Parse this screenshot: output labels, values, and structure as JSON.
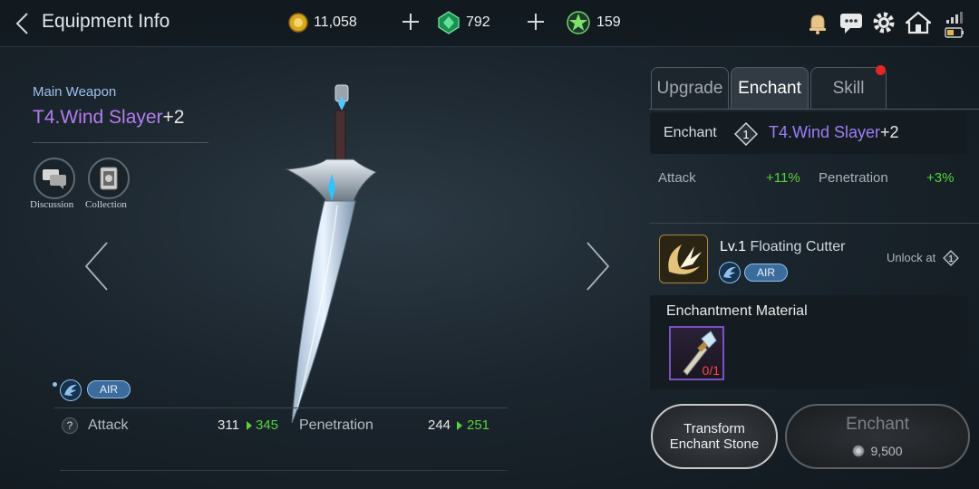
{
  "header": {
    "title": "Equipment Info",
    "gold": "11,058",
    "gems": "792",
    "stones": "159"
  },
  "weapon": {
    "type": "Main Weapon",
    "name": "T4.Wind Slayer",
    "plus": "+2",
    "element": "AIR"
  },
  "side_buttons": {
    "discussion": "Discussion",
    "collection": "Collection"
  },
  "stats": {
    "attack_label": "Attack",
    "attack_old": "311",
    "attack_new": "345",
    "pen_label": "Penetration",
    "pen_old": "244",
    "pen_new": "251"
  },
  "tabs": [
    "Upgrade",
    "Enchant",
    "Skill"
  ],
  "enchant_panel": {
    "label": "Enchant",
    "level": "1",
    "weapon_name": "T4.Wind Slayer",
    "weapon_plus": "+2",
    "attack_label": "Attack",
    "attack_bonus": "+11%",
    "pen_label": "Penetration",
    "pen_bonus": "+3%"
  },
  "skill": {
    "level": "Lv.1",
    "name": "Floating Cutter",
    "element": "AIR",
    "unlock_label": "Unlock at",
    "unlock_level": "1"
  },
  "material": {
    "title": "Enchantment Material",
    "count": "0/1"
  },
  "buttons": {
    "transform_line1": "Transform",
    "transform_line2": "Enchant Stone",
    "enchant": "Enchant",
    "cost": "9,500"
  },
  "colors": {
    "weapon_name": "#b47cf0",
    "bonus_green": "#58d23e",
    "notification_dot": "#e32626"
  }
}
